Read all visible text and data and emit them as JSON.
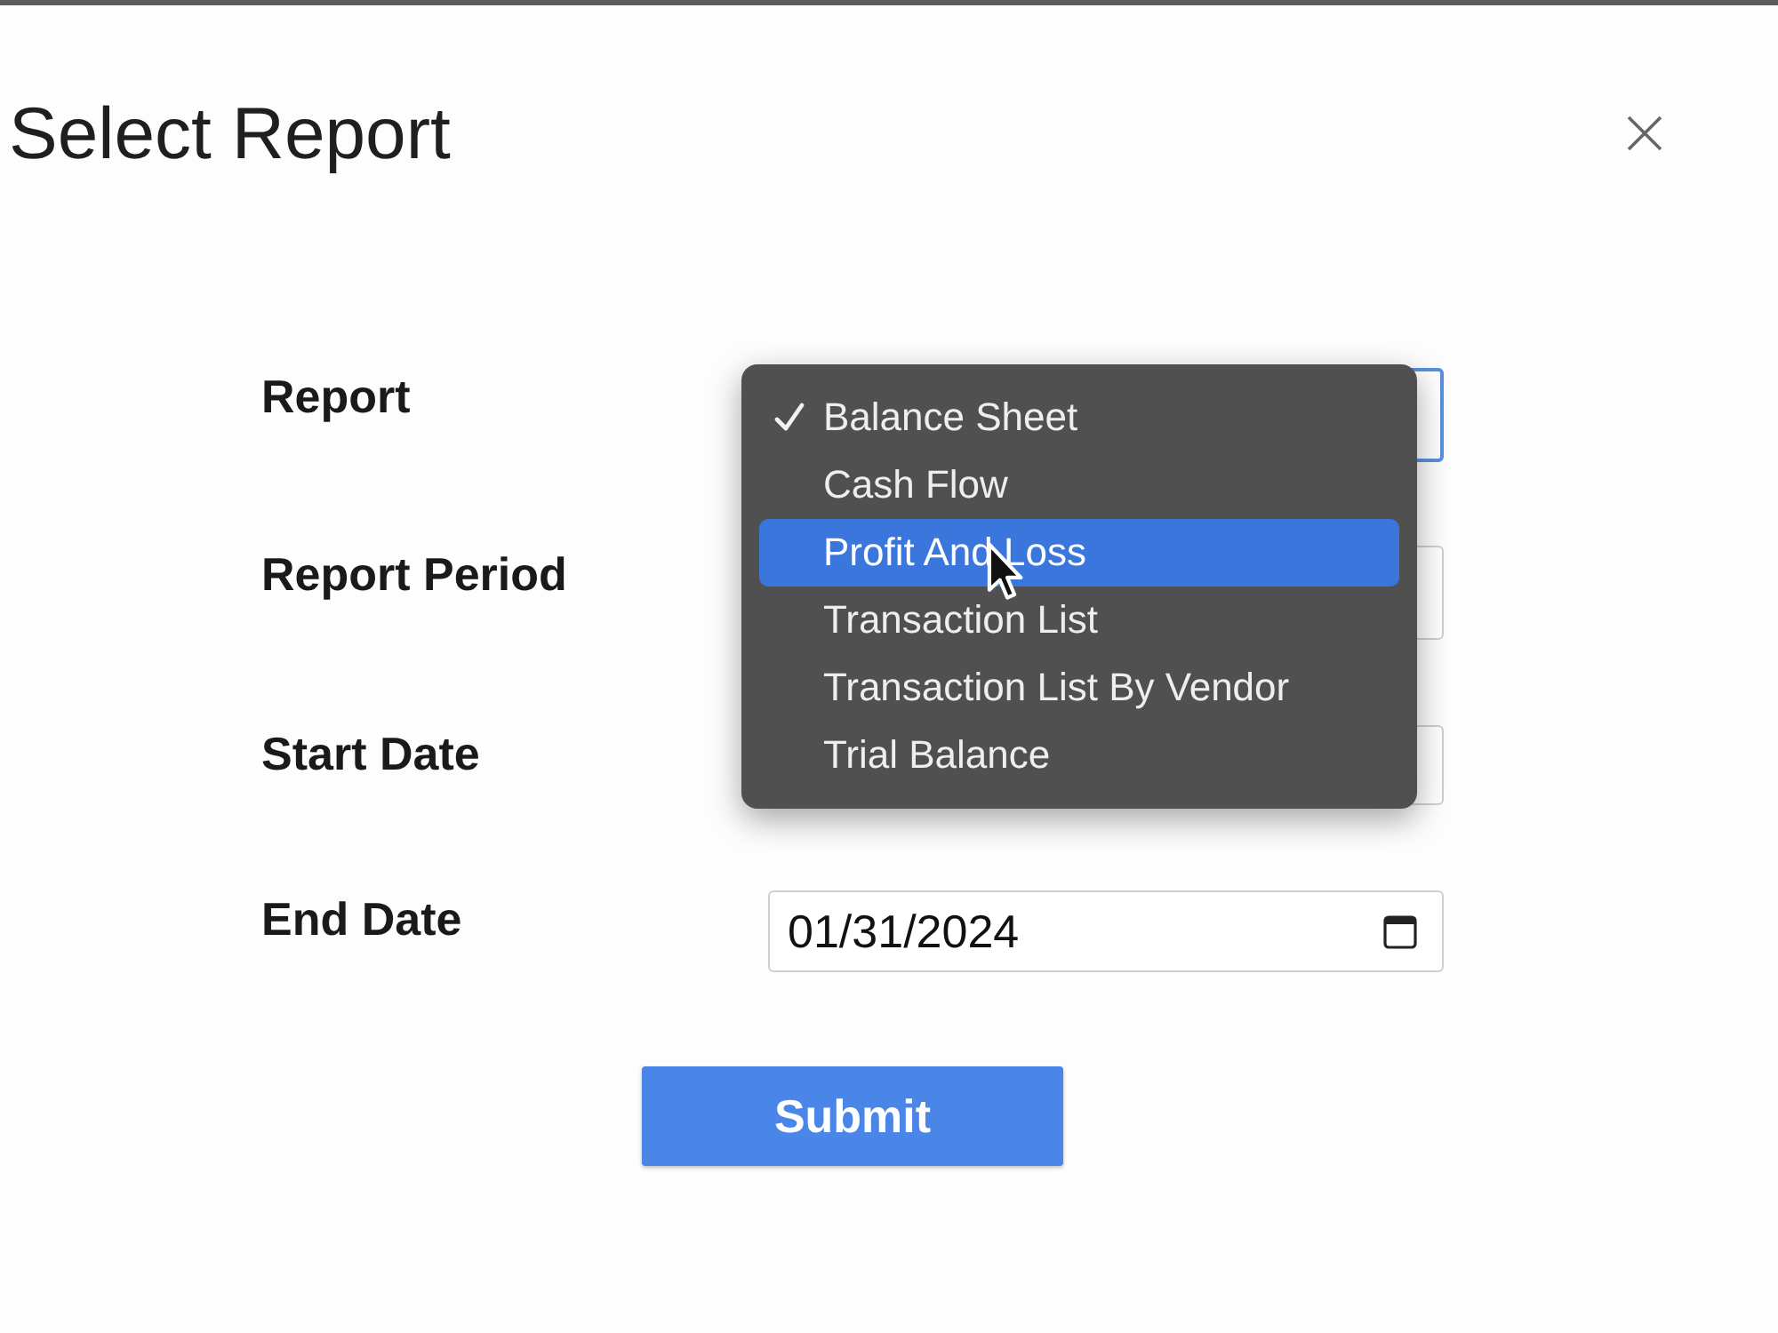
{
  "dialog": {
    "title": "Select Report"
  },
  "fields": [
    {
      "label": "Report",
      "kind": "box",
      "focused": true
    },
    {
      "label": "Report Period",
      "kind": "box",
      "focused": false
    },
    {
      "label": "Start Date",
      "kind": "box",
      "focused": false
    },
    {
      "label": "End Date",
      "kind": "date",
      "focused": false,
      "value": "01/31/2024"
    }
  ],
  "dropdown": {
    "options": [
      {
        "label": "Balance Sheet",
        "selected": true,
        "highlighted": false
      },
      {
        "label": "Cash Flow",
        "selected": false,
        "highlighted": false
      },
      {
        "label": "Profit And Loss",
        "selected": false,
        "highlighted": true
      },
      {
        "label": "Transaction List",
        "selected": false,
        "highlighted": false
      },
      {
        "label": "Transaction List By Vendor",
        "selected": false,
        "highlighted": false
      },
      {
        "label": "Trial Balance",
        "selected": false,
        "highlighted": false
      }
    ]
  },
  "submit": {
    "label": "Submit"
  }
}
